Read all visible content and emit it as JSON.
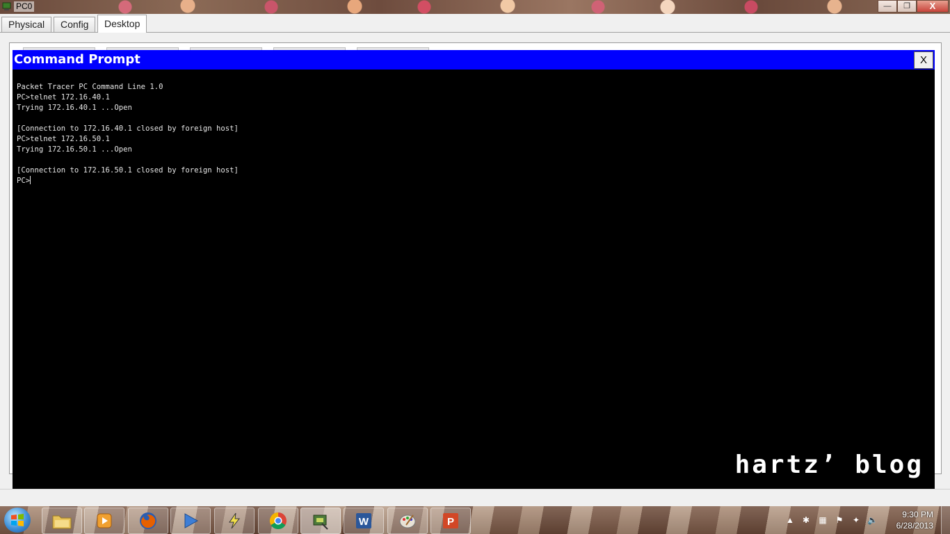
{
  "window": {
    "title": "PC0",
    "minimize_label": "—",
    "maximize_label": "❐",
    "close_label": "X"
  },
  "tabs": [
    {
      "label": "Physical",
      "active": false
    },
    {
      "label": "Config",
      "active": false
    },
    {
      "label": "Desktop",
      "active": true
    }
  ],
  "command_prompt": {
    "title": "Command Prompt",
    "close_label": "X",
    "lines": [
      "Packet Tracer PC Command Line 1.0",
      "PC>telnet 172.16.40.1",
      "Trying 172.16.40.1 ...Open",
      "",
      "[Connection to 172.16.40.1 closed by foreign host]",
      "PC>telnet 172.16.50.1",
      "Trying 172.16.50.1 ...Open",
      "",
      "[Connection to 172.16.50.1 closed by foreign host]"
    ],
    "prompt": "PC>",
    "watermark": "hartz’ blog"
  },
  "taskbar": {
    "apps": [
      {
        "name": "windows-explorer",
        "icon": "folder-icon",
        "active": false
      },
      {
        "name": "media-center",
        "icon": "media-player-icon",
        "active": false
      },
      {
        "name": "firefox",
        "icon": "firefox-icon",
        "active": false
      },
      {
        "name": "media-player",
        "icon": "play-icon",
        "active": false
      },
      {
        "name": "winamp",
        "icon": "lightning-icon",
        "active": false
      },
      {
        "name": "chrome",
        "icon": "chrome-icon",
        "active": false
      },
      {
        "name": "packet-tracer",
        "icon": "packet-tracer-icon",
        "active": true
      },
      {
        "name": "word",
        "icon": "word-icon",
        "active": false
      },
      {
        "name": "paint",
        "icon": "paint-icon",
        "active": false
      },
      {
        "name": "powerpoint",
        "icon": "powerpoint-icon",
        "active": false
      }
    ],
    "clock": {
      "time": "9:30 PM",
      "date": "6/28/2013"
    }
  },
  "colors": {
    "cmd_header": "#0000ff",
    "terminal_bg": "#000000",
    "terminal_text": "#e6e6e6"
  }
}
